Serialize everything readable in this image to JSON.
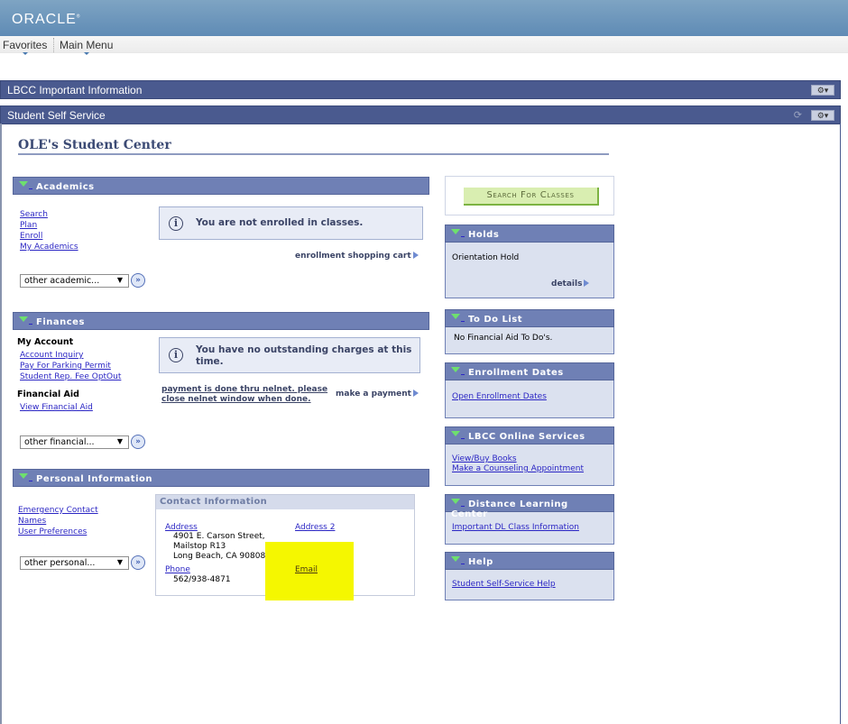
{
  "header": {
    "logo": "ORACLE",
    "nav": [
      "Favorites",
      "Main Menu"
    ]
  },
  "pagelets": {
    "important_info": "LBCC Important Information",
    "self_service": "Student Self Service",
    "gear_label": "⚙▾",
    "refresh_icon": "⟳"
  },
  "page": {
    "title": "OLE's Student Center"
  },
  "academics": {
    "header": "Academics",
    "links": [
      "Search",
      "Plan",
      "Enroll",
      "My Academics"
    ],
    "message": "You are not enrolled in classes.",
    "cart_action": "enrollment shopping cart",
    "dropdown": "other academic..."
  },
  "finances": {
    "header": "Finances",
    "my_account_label": "My Account",
    "my_account_links": [
      "Account Inquiry",
      "Pay For Parking Permit",
      "Student Rep. Fee OptOut"
    ],
    "aid_label": "Financial Aid",
    "aid_links": [
      "View Financial Aid"
    ],
    "message_line1": "You have no outstanding charges at this",
    "message_line2": "time.",
    "nelnet_line1": "payment is done thru nelnet. please",
    "nelnet_line2": "close nelnet window when done.",
    "pay_action": "make a payment",
    "dropdown": "other financial..."
  },
  "personal": {
    "header": "Personal Information",
    "links": [
      "Emergency Contact",
      "Names",
      "User Preferences"
    ],
    "dropdown": "other personal...",
    "contact": {
      "header": "Contact Information",
      "address_label": "Address",
      "address_lines": [
        "4901 E. Carson Street,",
        "Mailstop R13",
        "Long Beach, CA 90808"
      ],
      "address2_label": "Address 2",
      "phone_label": "Phone",
      "phone": "562/938-4871",
      "email_label": "Email"
    },
    "highlight_color": "#f5f700"
  },
  "sidebar": {
    "search_button": "Search For Classes",
    "holds": {
      "header": "Holds",
      "item": "Orientation Hold",
      "action": "details"
    },
    "todo": {
      "header": "To Do List",
      "item": "No Financial Aid To Do's."
    },
    "enrollment_dates": {
      "header": "Enrollment Dates",
      "link": "Open Enrollment Dates"
    },
    "online_services": {
      "header": "LBCC Online Services",
      "links": [
        "View/Buy Books",
        "Make a Counseling Appointment"
      ]
    },
    "distance": {
      "header": "Distance Learning Center",
      "link": "Important DL Class Information"
    },
    "help": {
      "header": "Help",
      "link": "Student Self-Service Help"
    }
  },
  "colors": {
    "brand_bar": "#6a94bb",
    "pagelet_bar": "#4a5a8f",
    "section_header": "#6f80b5",
    "link": "#2b26c4",
    "panel_bg": "#dbe1ef"
  }
}
